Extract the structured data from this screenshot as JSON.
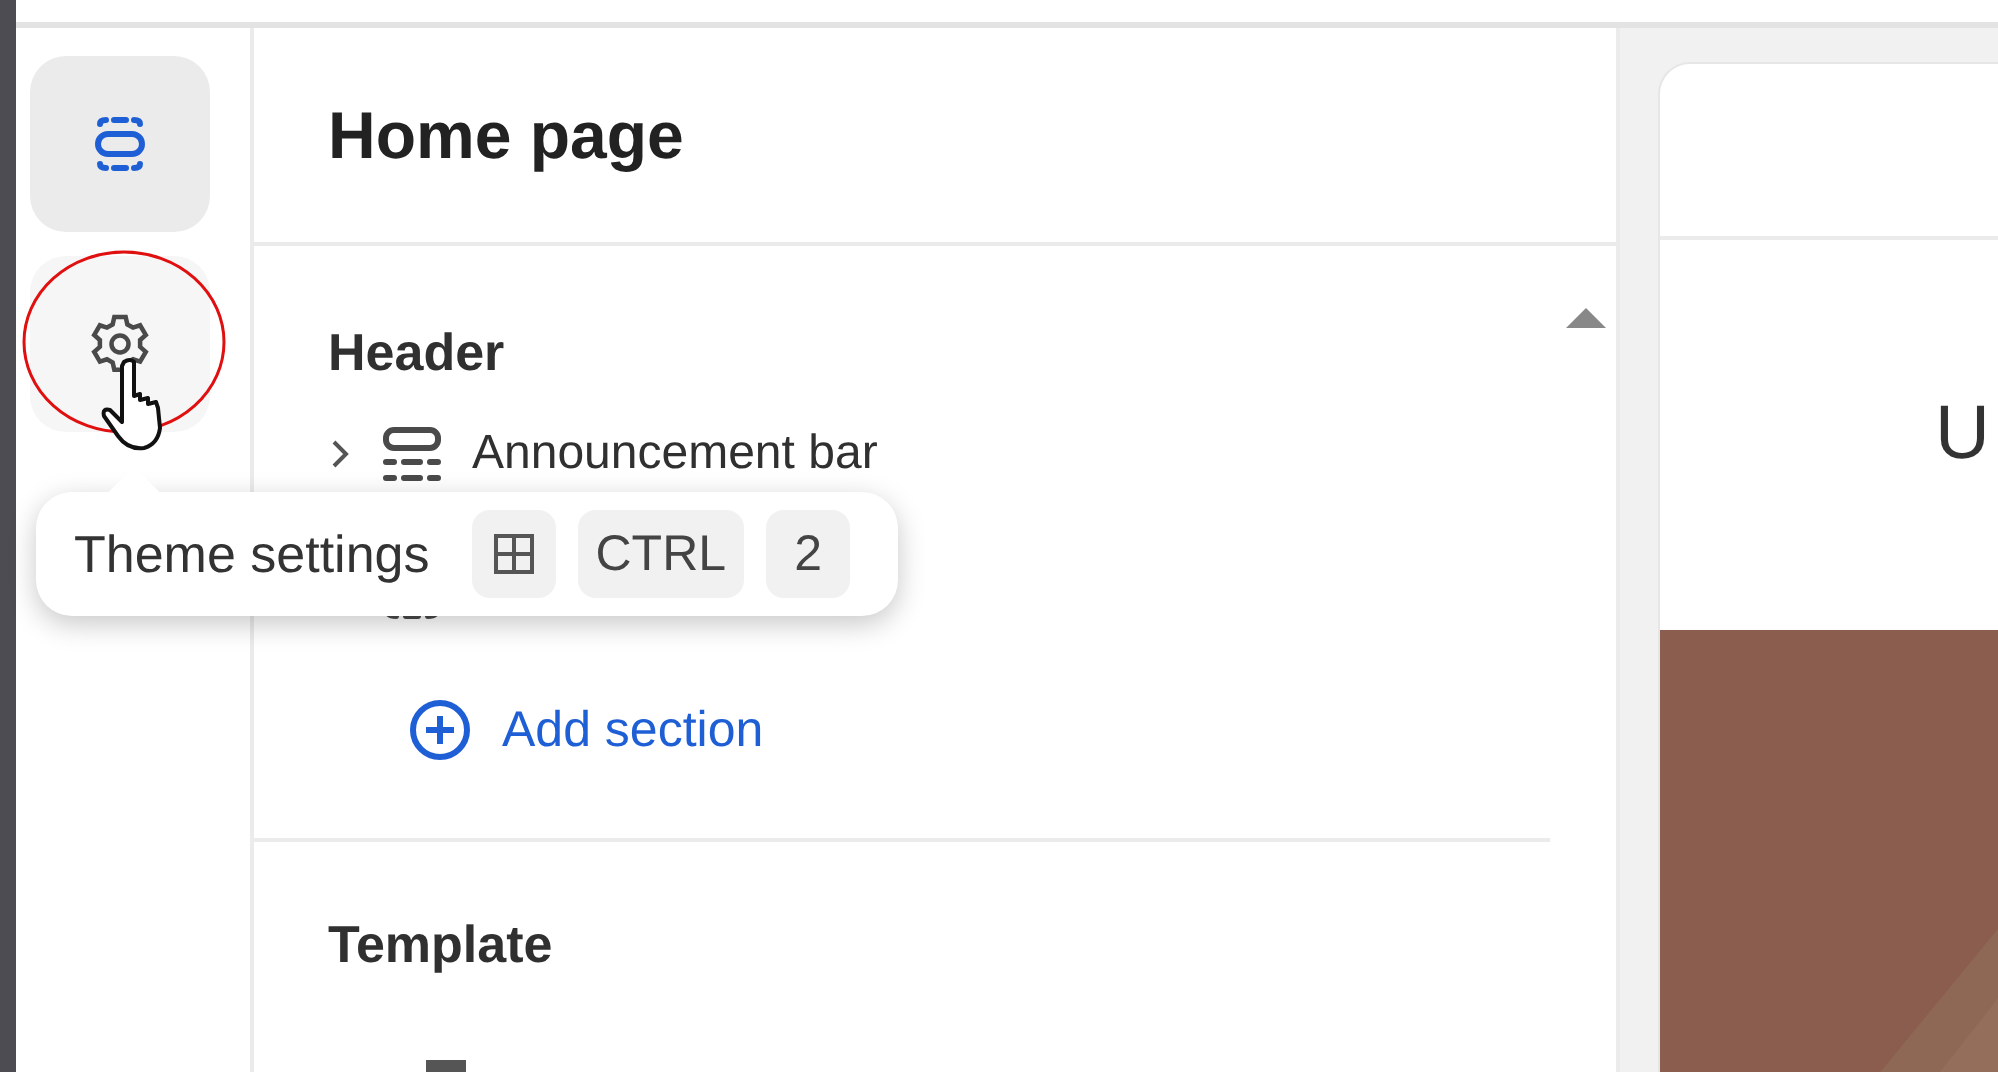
{
  "rail": [
    {
      "kind": "sections",
      "selected": true
    },
    {
      "kind": "settings",
      "selected": false
    }
  ],
  "panel": {
    "title": "Home page",
    "groups": [
      {
        "title": "Header",
        "expanded": true,
        "items": [
          {
            "kind": "announcement",
            "label": "Announcement bar"
          },
          {
            "kind": "header"
          }
        ],
        "add_label": "Add section"
      },
      {
        "title": "Template"
      }
    ]
  },
  "tooltip": {
    "label": "Theme settings",
    "keys": [
      {
        "kind": "icon"
      },
      {
        "kind": "text",
        "label": "CTRL"
      },
      {
        "kind": "text",
        "label": "2"
      }
    ]
  },
  "preview": {
    "text": "U"
  }
}
